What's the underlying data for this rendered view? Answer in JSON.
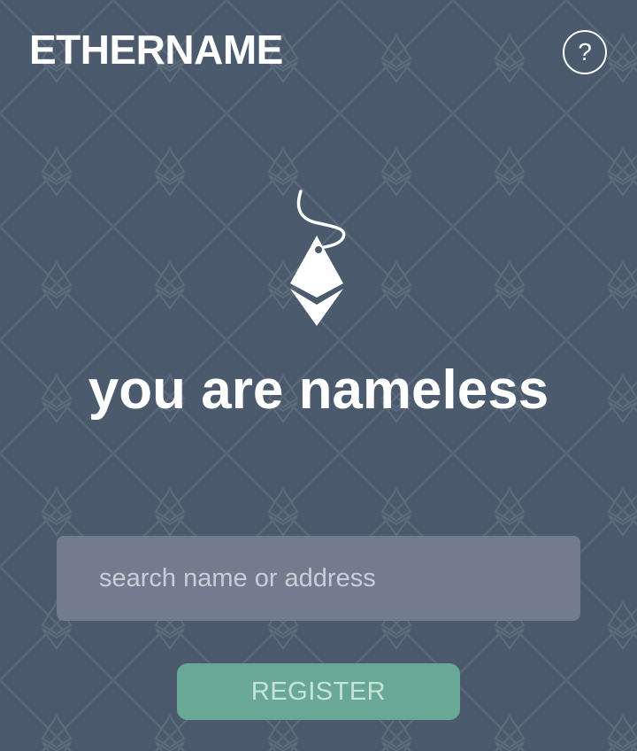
{
  "header": {
    "title": "ETHERNAME",
    "help_label": "?",
    "help_icon": "question-mark-icon"
  },
  "hero": {
    "logo_icon": "ether-tag-icon",
    "heading": "you are nameless"
  },
  "search": {
    "placeholder": "search name or address",
    "value": ""
  },
  "actions": {
    "register_label": "REGISTER"
  },
  "colors": {
    "background": "#4b5a6d",
    "input_background": "#727c8e",
    "register_button": "#68a894",
    "text": "#ffffff"
  }
}
